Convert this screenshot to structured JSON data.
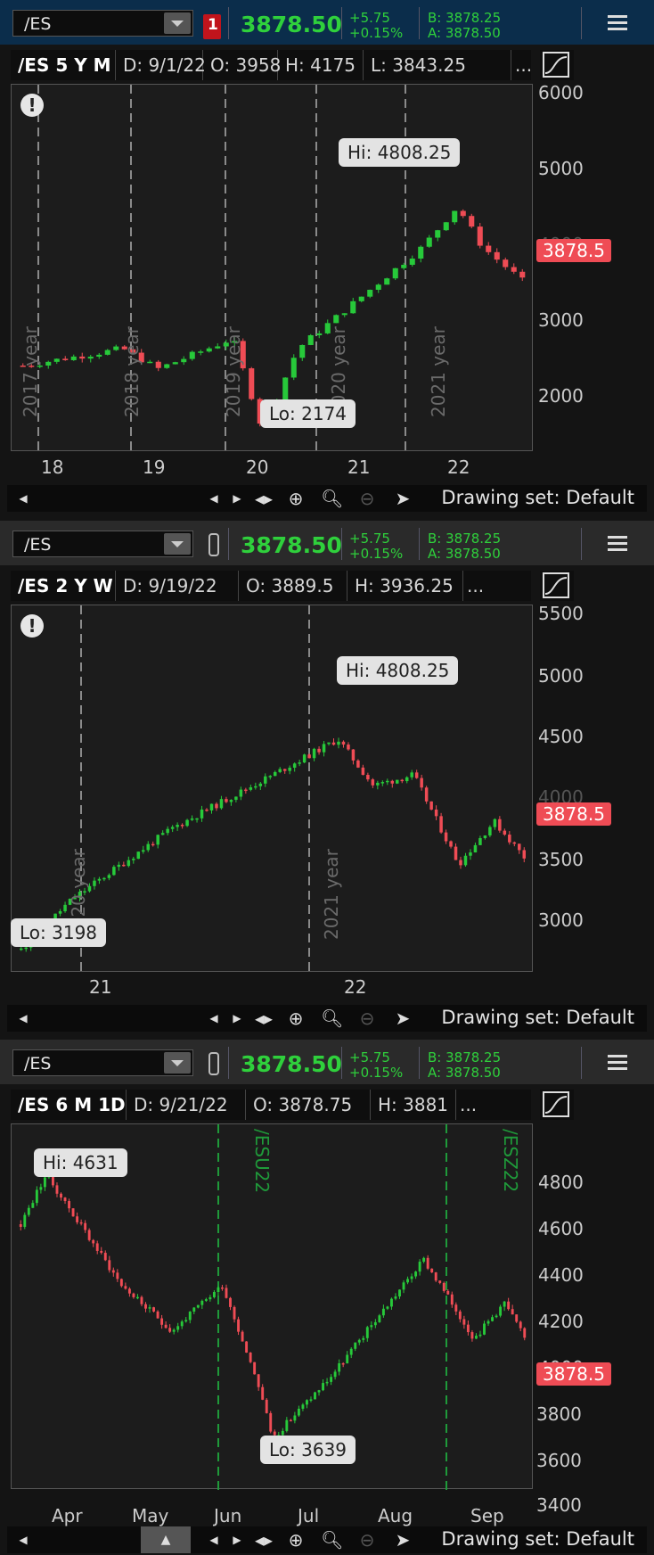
{
  "colors": {
    "up": "#27c93a",
    "down": "#ef4c55",
    "accent_green": "#2fd03c",
    "header_blue": "#0b2d4b"
  },
  "quote": {
    "symbol": "/ES",
    "last": "3878.50",
    "change": "+5.75",
    "change_pct": "+0.15%",
    "bid": "B: 3878.25",
    "ask": "A: 3878.50"
  },
  "panels": [
    {
      "link_badge": "1",
      "title": "/ES 5 Y M",
      "date": "D: 9/1/22",
      "open": "O: 3958",
      "high": "H: 4175",
      "low": "L: 3843.25",
      "more": "...",
      "last_label": "3878.5",
      "hi_label": "Hi: 4808.25",
      "lo_label": "Lo: 2174",
      "y_ticks": [
        "6000",
        "5000",
        "4000",
        "3000",
        "2000"
      ],
      "x_ticks": [
        "18",
        "19",
        "20",
        "21",
        "22"
      ],
      "year_markers": [
        "2017 year",
        "2018 year",
        "2019 year",
        "2020 year",
        "2021 year"
      ],
      "drawing_set": "Drawing set: Default"
    },
    {
      "title": "/ES 2 Y W",
      "date": "D: 9/19/22",
      "open": "O: 3889.5",
      "high": "H: 3936.25",
      "more": "...",
      "last_label": "3878.5",
      "hi_label": "Hi: 4808.25",
      "lo_label": "Lo: 3198",
      "y_ticks": [
        "5500",
        "5000",
        "4500",
        "4000",
        "3500",
        "3000"
      ],
      "x_ticks": [
        "21",
        "22"
      ],
      "year_markers": [
        "2020 year",
        "2021 year"
      ],
      "drawing_set": "Drawing set: Default"
    },
    {
      "title": "/ES 6 M 1D",
      "date": "D: 9/21/22",
      "open": "O: 3878.75",
      "high": "H: 3881",
      "more": "...",
      "last_label": "3878.5",
      "hi_label": "Hi: 4631",
      "lo_label": "Lo: 3639",
      "y_ticks": [
        "4800",
        "4600",
        "4400",
        "4200",
        "4000",
        "3800",
        "3600",
        "3400"
      ],
      "x_ticks": [
        "Apr",
        "May",
        "Jun",
        "Jul",
        "Aug",
        "Sep"
      ],
      "contract_markers": [
        "/ESU22",
        "/ESZ22"
      ],
      "drawing_set": "Drawing set: Default"
    }
  ]
}
